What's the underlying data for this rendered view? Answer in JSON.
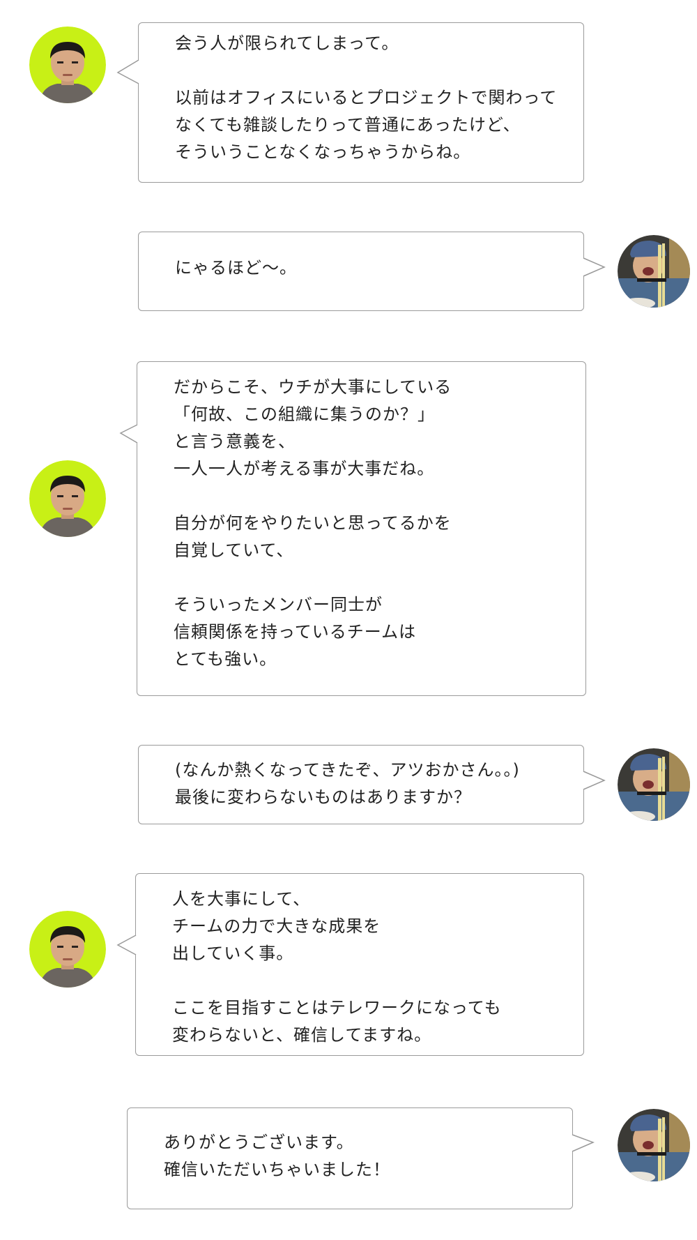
{
  "colors": {
    "avatar_left_bg": "#c8f016",
    "bubble_border": "#9a9a9a",
    "text": "#222222"
  },
  "avatars": {
    "left_icon": "man-portrait-icon",
    "right_icon": "woman-eating-noodles-icon"
  },
  "messages": [
    {
      "speaker": "left",
      "text": "会う人が限られてしまって。\n\n以前はオフィスにいるとプロジェクトで関わって\nなくても雑談したりって普通にあったけど、\nそういうことなくなっちゃうからね。"
    },
    {
      "speaker": "right",
      "text": "にゃるほど〜。"
    },
    {
      "speaker": "left",
      "text": "だからこそ、ウチが大事にしている\n「何故、この組織に集うのか？」\nと言う意義を、\n一人一人が考える事が大事だね。\n\n自分が何をやりたいと思ってるかを\n自覚していて、\n\nそういったメンバー同士が\n信頼関係を持っているチームは\nとても強い。"
    },
    {
      "speaker": "right",
      "text": "(なんか熱くなってきたぞ、アツおかさん。。)\n最後に変わらないものはありますか？"
    },
    {
      "speaker": "left",
      "text": "人を大事にして、\nチームの力で大きな成果を\n出していく事。\n\nここを目指すことはテレワークになっても\n変わらないと、確信してますね。"
    },
    {
      "speaker": "right",
      "text": "ありがとうございます。\n確信いただいちゃいました！"
    }
  ]
}
